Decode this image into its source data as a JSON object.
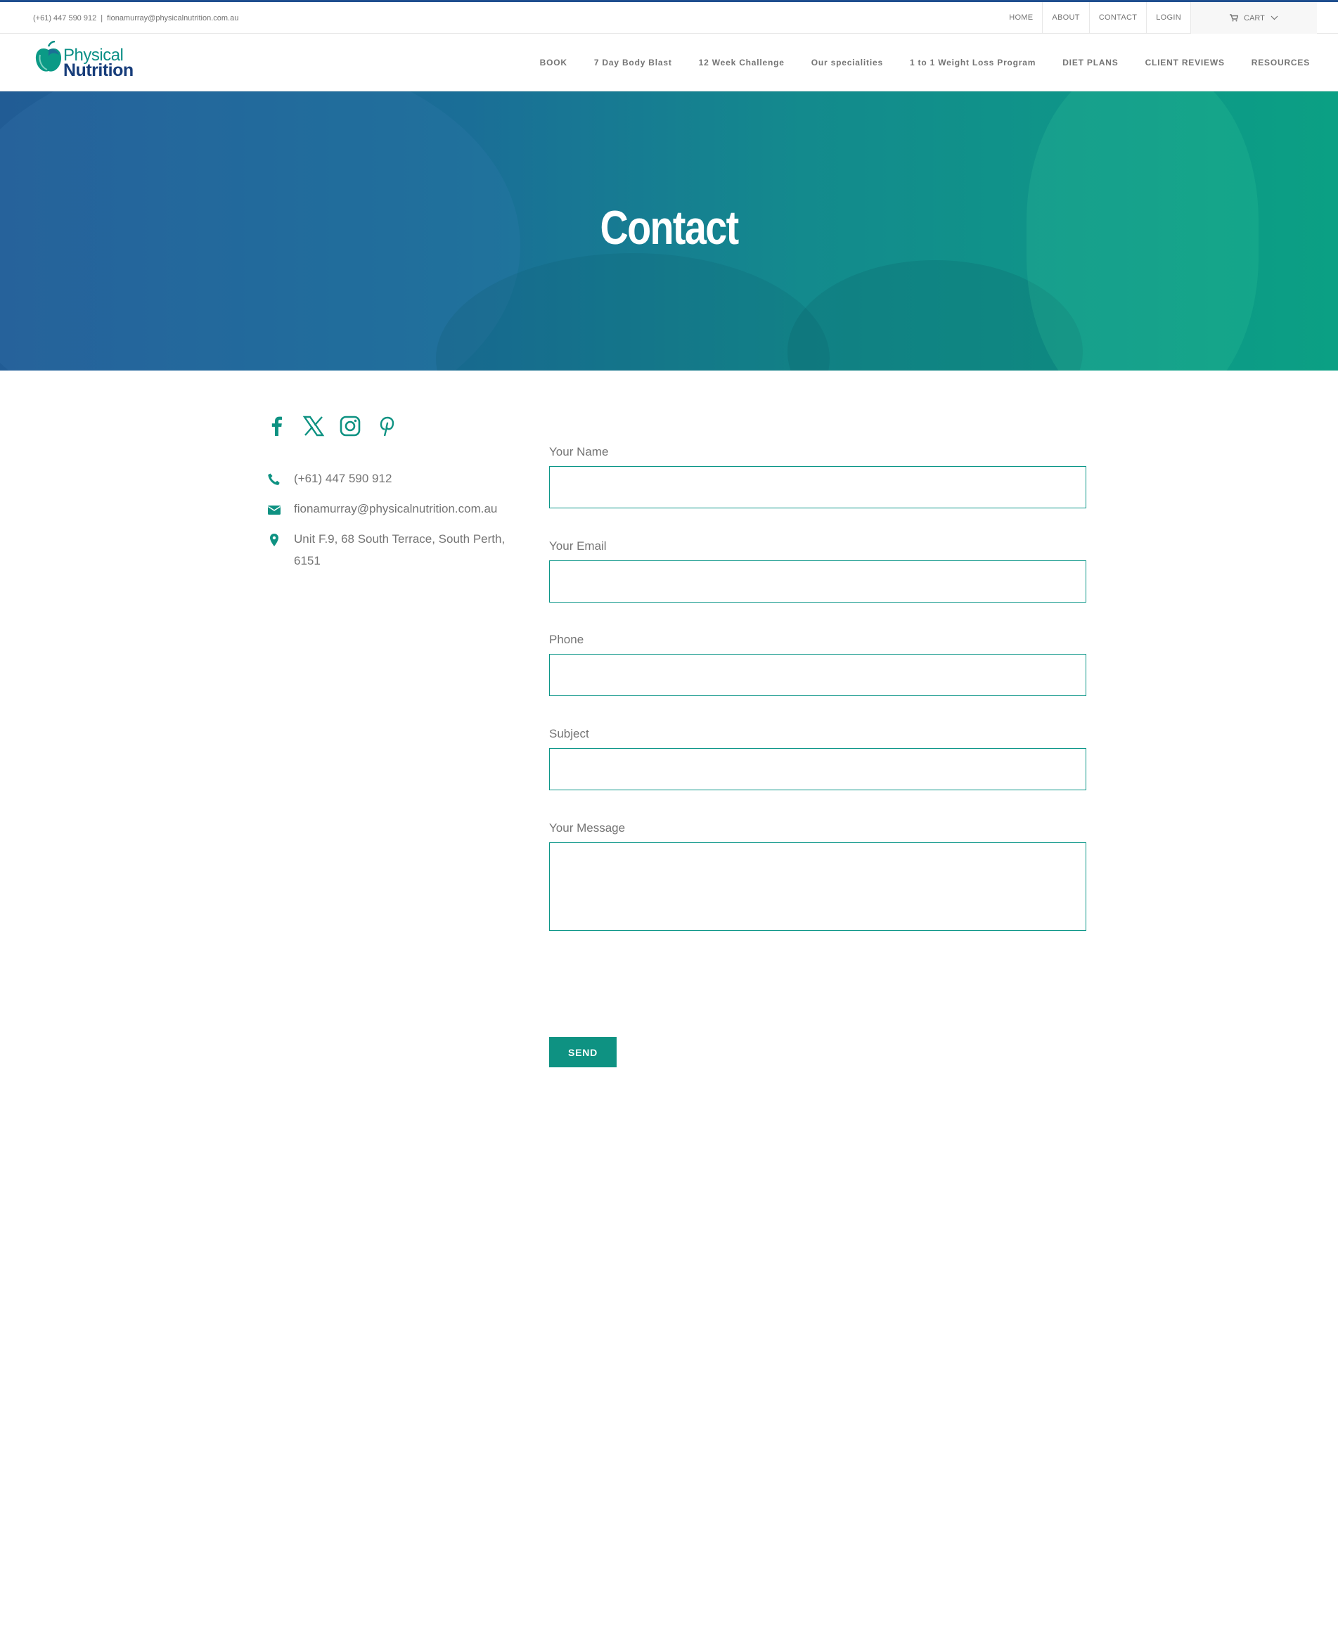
{
  "topbar": {
    "phone": "(+61) 447 590 912",
    "separator": "|",
    "email": "fionamurray@physicalnutrition.com.au",
    "links": [
      "HOME",
      "ABOUT",
      "CONTACT",
      "LOGIN"
    ],
    "cart_label": "CART"
  },
  "logo": {
    "line1": "Physical",
    "line2": "Nutrition"
  },
  "nav": {
    "items": [
      "BOOK",
      "7 Day Body Blast",
      "12 Week Challenge",
      "Our specialities",
      "1 to 1 Weight Loss Program",
      "DIET PLANS",
      "CLIENT REVIEWS",
      "RESOURCES"
    ]
  },
  "hero": {
    "title": "Contact"
  },
  "social": [
    "facebook-icon",
    "x-icon",
    "instagram-icon",
    "pinterest-icon"
  ],
  "contact": {
    "phone": "(+61) 447 590 912",
    "email": "fionamurray@physicalnutrition.com.au",
    "address": "Unit F.9, 68 South Terrace, South Perth, 6151"
  },
  "form": {
    "name_label": "Your Name",
    "email_label": "Your Email",
    "phone_label": "Phone",
    "subject_label": "Subject",
    "message_label": "Your Message",
    "send_label": "SEND"
  },
  "colors": {
    "accent": "#0e9282",
    "brand_blue": "#173d7a",
    "topbar_border": "#1f4f8f"
  }
}
